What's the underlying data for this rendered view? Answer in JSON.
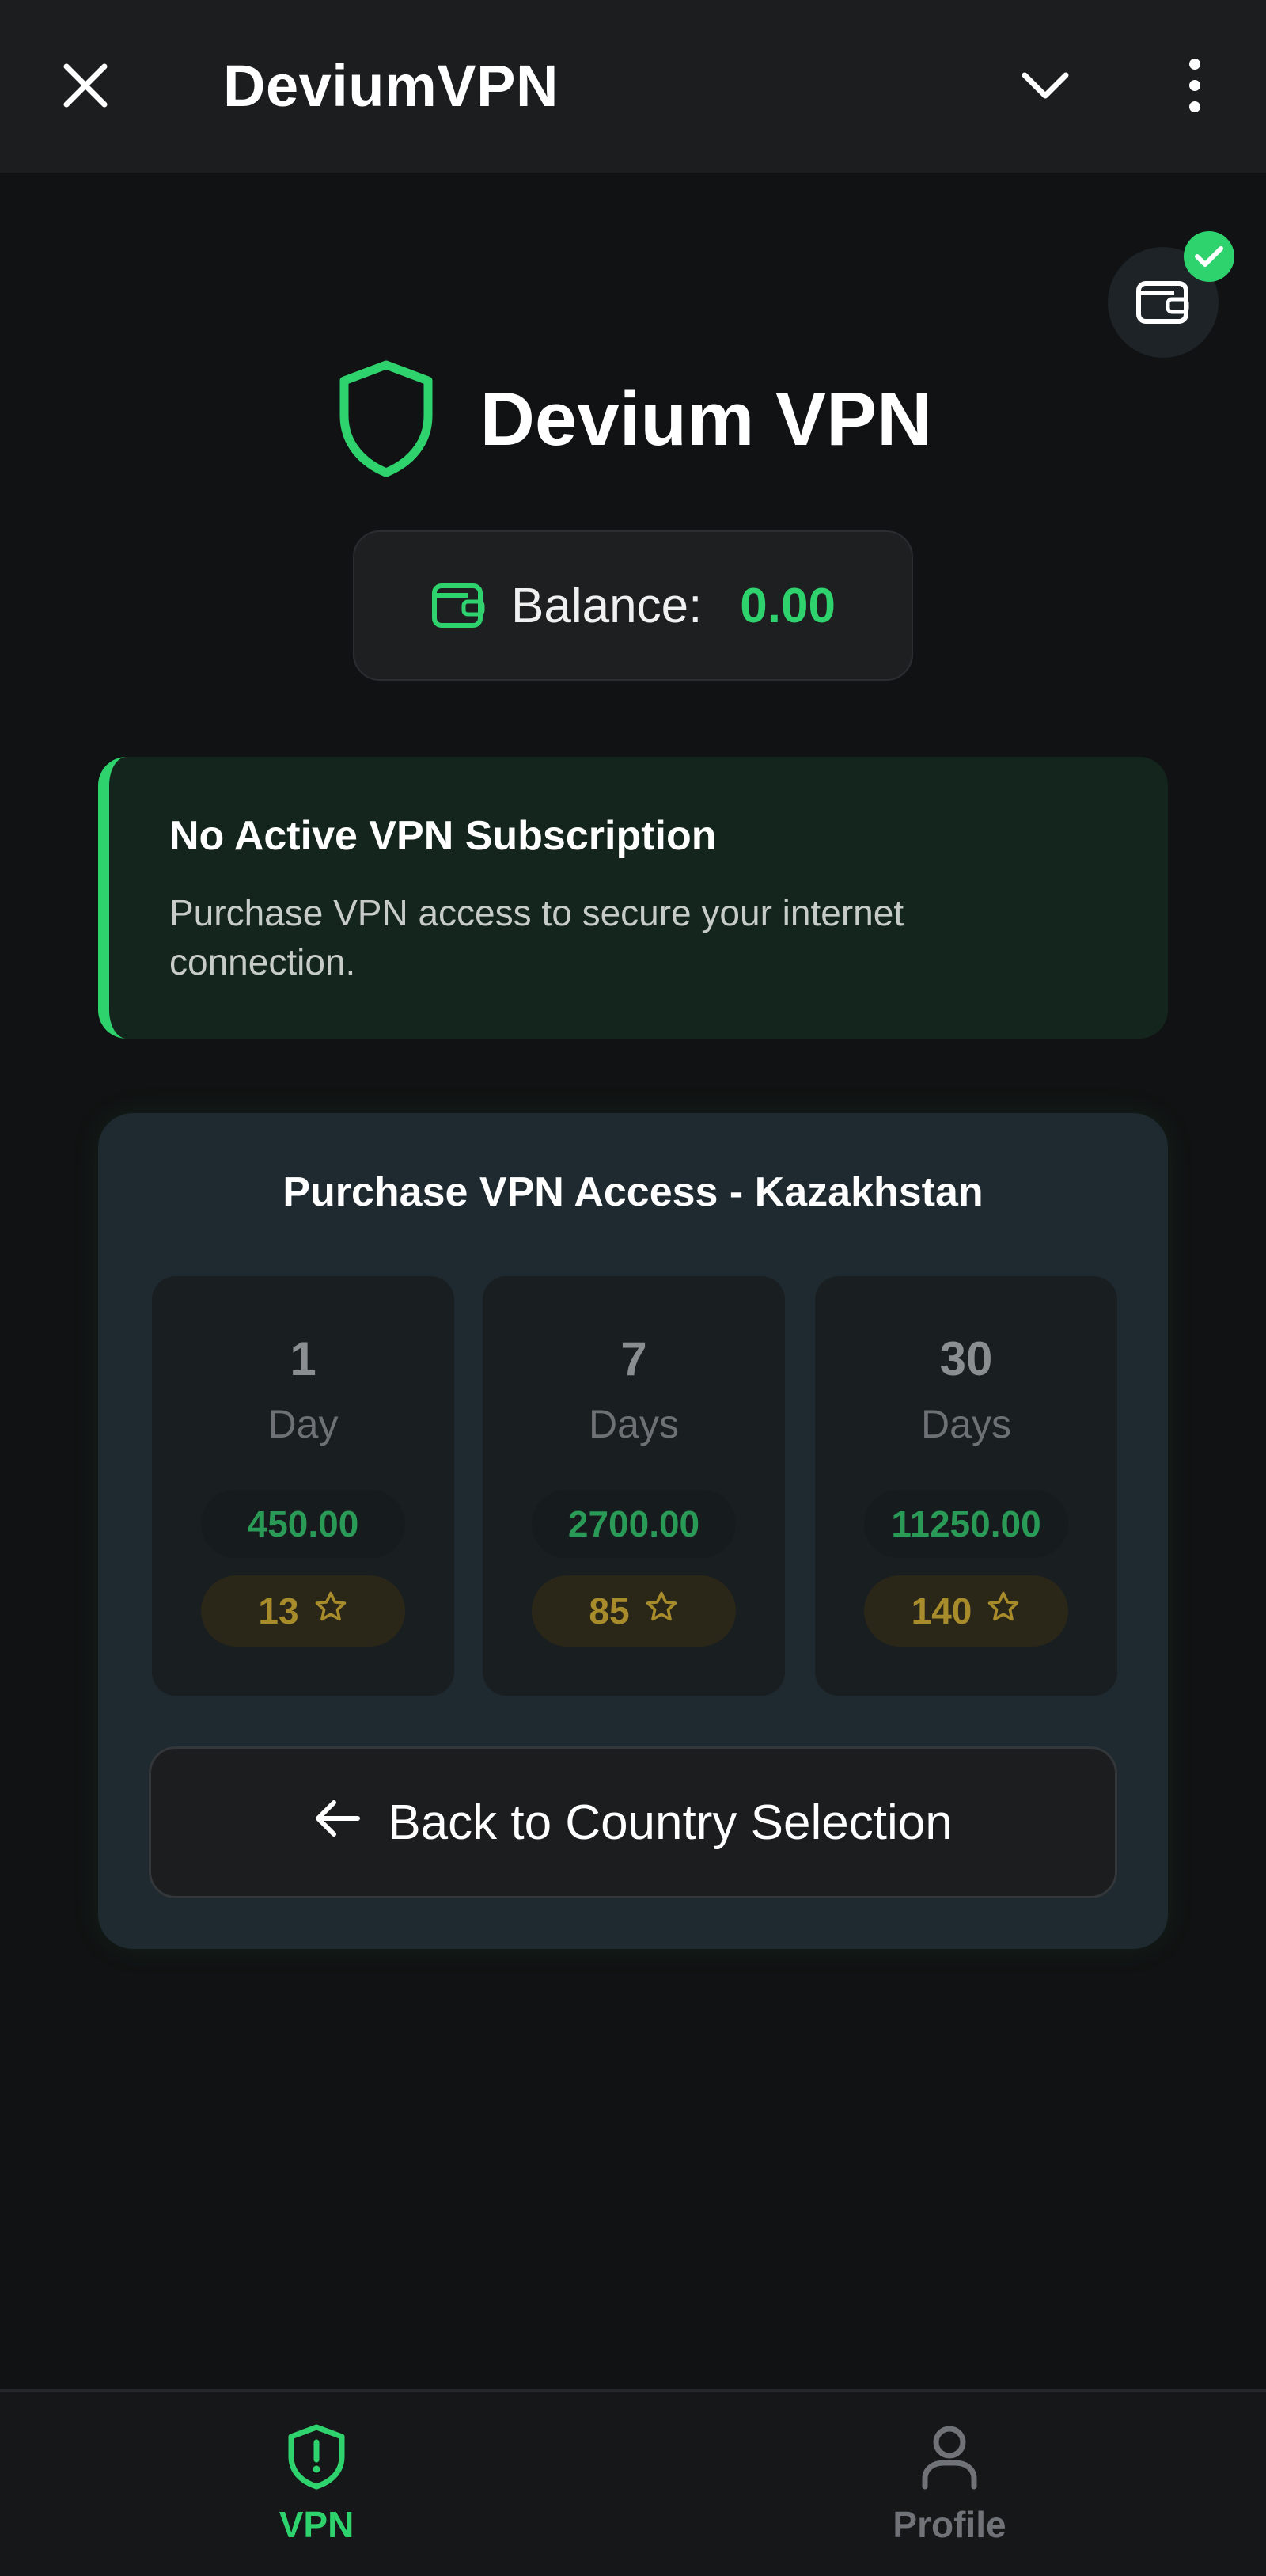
{
  "header": {
    "title": "DeviumVPN",
    "close_icon": "close-icon",
    "chevron_icon": "chevron-down-icon",
    "more_icon": "more-vertical-icon"
  },
  "wallet_fab": {
    "icon": "wallet-icon",
    "badge_icon": "check-icon"
  },
  "brand": {
    "name": "Devium VPN",
    "icon": "shield-icon"
  },
  "balance": {
    "label": "Balance:",
    "value": "0.00",
    "icon": "wallet-icon"
  },
  "alert": {
    "title": "No Active VPN Subscription",
    "message": "Purchase VPN access to secure your internet connection."
  },
  "purchase": {
    "title": "Purchase VPN Access - Kazakhstan",
    "plans": [
      {
        "duration": "1",
        "unit": "Day",
        "price": "450.00",
        "stars": "13"
      },
      {
        "duration": "7",
        "unit": "Days",
        "price": "2700.00",
        "stars": "85"
      },
      {
        "duration": "30",
        "unit": "Days",
        "price": "11250.00",
        "stars": "140"
      }
    ],
    "back_label": "Back to Country Selection"
  },
  "nav": {
    "items": [
      {
        "label": "VPN",
        "icon": "shield-alert-icon",
        "active": true
      },
      {
        "label": "Profile",
        "icon": "user-icon",
        "active": false
      }
    ]
  },
  "colors": {
    "accent": "#2ed36d",
    "background": "#111213",
    "gold": "#a88c2b"
  }
}
